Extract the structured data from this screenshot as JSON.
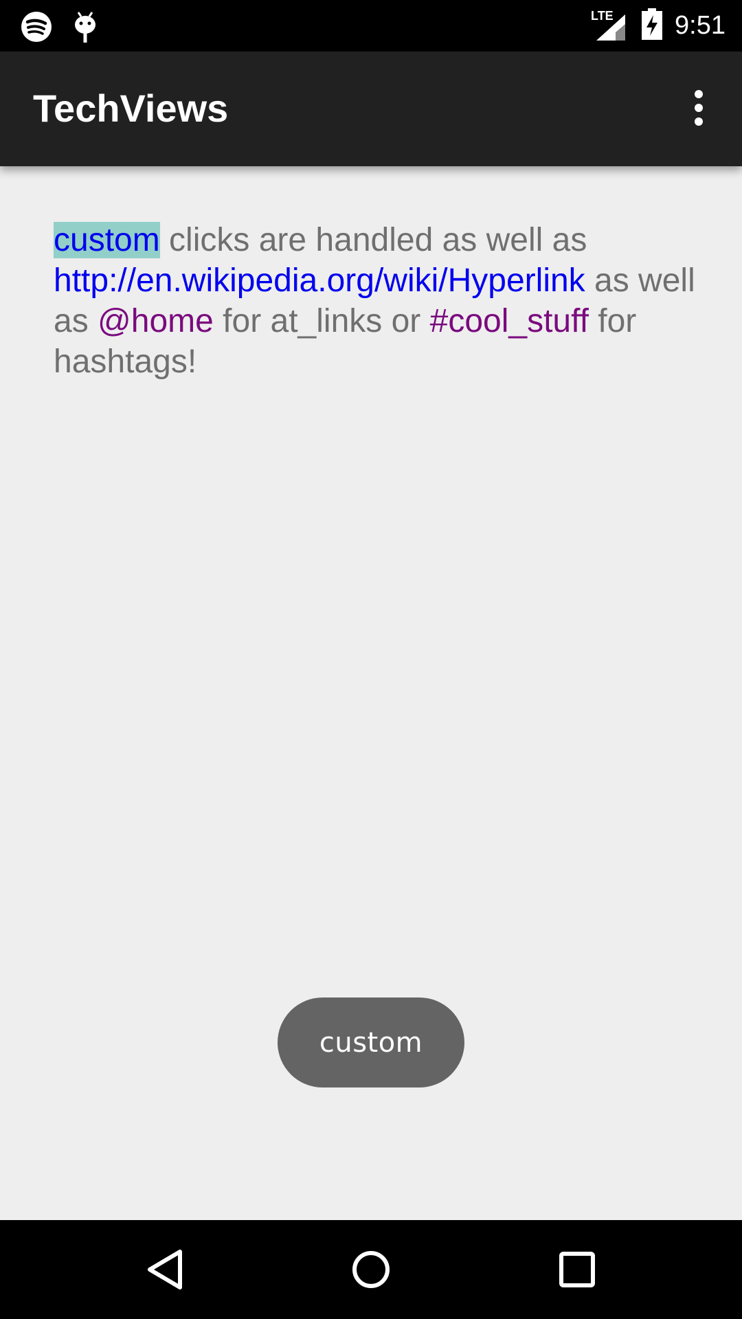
{
  "status_bar": {
    "left_icons": [
      "spotify-icon",
      "android-debug-icon"
    ],
    "network_label": "LTE",
    "time": "9:51"
  },
  "app_bar": {
    "title": "TechViews",
    "overflow_icon": "more-vert-icon"
  },
  "content": {
    "segments": {
      "custom_link": "custom",
      "text_1": " clicks are handled as well as ",
      "url_link": "http://en.wikipedia.org/wiki/Hyperlink",
      "text_2": " as well as ",
      "mention_link": "@home",
      "text_3": " for at_links or ",
      "hashtag_link": "#cool_stuff",
      "text_4": " for hashtags!"
    },
    "colors": {
      "body_text": "#6f6f6f",
      "link": "#0000ee",
      "mention_hashtag": "#7a0a7e",
      "highlight": "#91cfc8"
    }
  },
  "toast": {
    "text": "custom"
  },
  "nav_bar": {
    "buttons": [
      "back-icon",
      "home-icon",
      "recents-icon"
    ]
  }
}
